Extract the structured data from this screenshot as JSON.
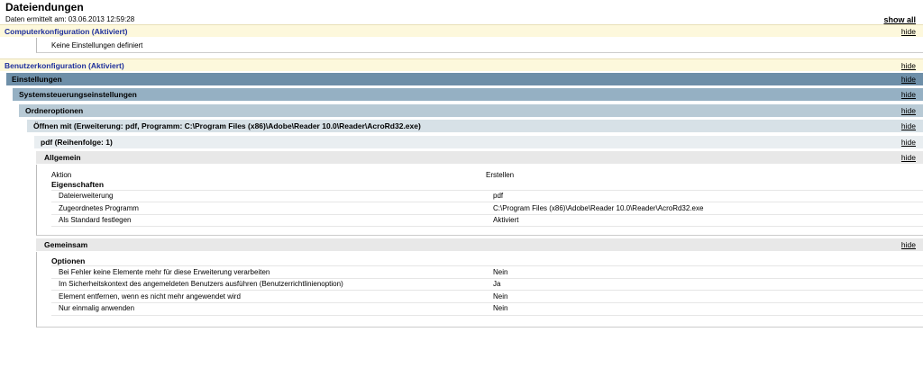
{
  "header": {
    "title": "Dateiendungen",
    "date": "Daten ermittelt am: 03.06.2013 12:59:28",
    "show_all": "show all"
  },
  "hide_label": "hide",
  "computer": {
    "label": "Computerkonfiguration (Aktiviert)",
    "none": "Keine Einstellungen definiert"
  },
  "user": {
    "label": "Benutzerkonfiguration (Aktiviert)",
    "einstellungen": "Einstellungen",
    "systemsteuerung": "Systemsteuerungseinstellungen",
    "ordneroptionen": "Ordneroptionen",
    "oeffnen": "Öffnen mit (Erweiterung: pdf, Programm: C:\\Program Files (x86)\\Adobe\\Reader 10.0\\Reader\\AcroRd32.exe)",
    "pdf": "pdf (Reihenfolge: 1)",
    "allgemein": {
      "label": "Allgemein",
      "aktion_label": "Aktion",
      "aktion_value": "Erstellen",
      "eigenschaften": "Eigenschaften",
      "rows": [
        {
          "label": "Dateierweiterung",
          "value": "pdf"
        },
        {
          "label": "Zugeordnetes Programm",
          "value": "C:\\Program Files (x86)\\Adobe\\Reader 10.0\\Reader\\AcroRd32.exe"
        },
        {
          "label": "Als Standard festlegen",
          "value": "Aktiviert"
        }
      ]
    },
    "gemeinsam": {
      "label": "Gemeinsam",
      "optionen": "Optionen",
      "rows": [
        {
          "label": "Bei Fehler keine Elemente mehr für diese Erweiterung verarbeiten",
          "value": "Nein"
        },
        {
          "label": "Im Sicherheitskontext des angemeldeten Benutzers ausführen (Benutzerrichtlinienoption)",
          "value": "Ja"
        },
        {
          "label": "Element entfernen, wenn es nicht mehr angewendet wird",
          "value": "Nein"
        },
        {
          "label": "Nur einmalig anwenden",
          "value": "Nein"
        }
      ]
    }
  }
}
